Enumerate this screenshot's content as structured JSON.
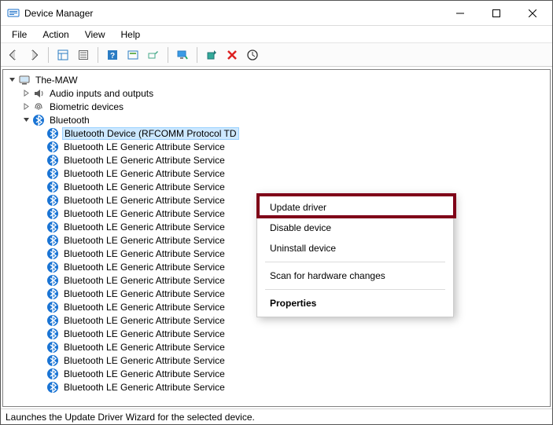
{
  "window": {
    "title": "Device Manager"
  },
  "menu": {
    "file": "File",
    "action": "Action",
    "view": "View",
    "help": "Help"
  },
  "tree": {
    "root": "The-MAW",
    "categories": [
      {
        "label": "Audio inputs and outputs",
        "icon": "speaker",
        "expanded": false
      },
      {
        "label": "Biometric devices",
        "icon": "fingerprint",
        "expanded": false
      },
      {
        "label": "Bluetooth",
        "icon": "bluetooth",
        "expanded": true
      }
    ],
    "selected_device": "Bluetooth Device (RFCOMM Protocol TD",
    "bt_child": "Bluetooth LE Generic Attribute Service",
    "bt_child_count": 19
  },
  "context_menu": {
    "update": "Update driver",
    "disable": "Disable device",
    "uninstall": "Uninstall device",
    "scan": "Scan for hardware changes",
    "properties": "Properties"
  },
  "statusbar": "Launches the Update Driver Wizard for the selected device.",
  "toolbar_icons": [
    "back",
    "forward",
    "show-hidden",
    "properties-sheet",
    "help",
    "update-view",
    "legacy",
    "monitor",
    "update-driver",
    "delete",
    "scan"
  ]
}
